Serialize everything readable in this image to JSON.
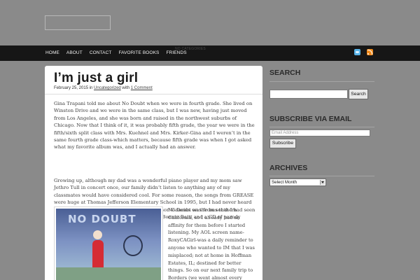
{
  "nav": {
    "items": [
      "HOME",
      "ABOUT",
      "CONTACT",
      "FAVORITE BOOKS",
      "FRIENDS"
    ],
    "sub_text": "NO CATEGORIES",
    "icons": [
      "twitter-icon",
      "rss-icon"
    ]
  },
  "post": {
    "title": "I’m just a girl",
    "date": "February 25, 2015",
    "in_text": "in",
    "category": "Uncategorized",
    "with_text": "with",
    "comments": "1 Comment",
    "paragraphs": [
      "Gina Trapani told me about No Doubt when we were in fourth grade. She lived on Winston Drive and we were in the same class, but I was new, having just moved from Los Angeles, and she was born and raised in the northwest suburbs of Chicago. Now that I think of it, it was probably fifth grade, the year we were in the fifth/sixth split class with Mrs. Kuehnel and Mrs. Kirker-Gina and I weren’t in the same fourth grade class-which matters, because fifth grade was when I got asked what my favorite album was, and I actually had an answer.",
      "Growing up, although my dad was a wonderful piano player and my mom saw Jethro Tull in concert once, our family didn’t listen to anything any of my classmates would have considered cool. For some reason, the songs from GREASE were huge at Thomas Jefferson Elementary School in 1995, but I had never heard of the movie except when I pretended to Allison Gaucius on the bus that I had seen it. Our family listened to Dan Fogelberg and Bonnie Raitt and a CD of parody songs called “Music to Operate By.”",
      "No Doubt was from southern California, so I already had an affinity for them before I started listening. My AOL screen name-RoxyCAGirl-was a daily reminder to anyone who wanted to IM that I was misplaced; not at home in Hoffman Estates, IL; destined for better things. So on our next family trip to Borders (we went almost every Sunday afternoon), I"
    ],
    "album_text": "NO DOUBT"
  },
  "sidebar": {
    "search_heading": "SEARCH",
    "search_button": "Search",
    "subscribe_heading": "SUBSCRIBE VIA EMAIL",
    "email_placeholder": "Email Address",
    "subscribe_button": "Subscribe",
    "archives_heading": "ARCHIVES",
    "archives_selected": "Select Month"
  },
  "colors": {
    "background": "#8a8a8a",
    "navbar": "#161616",
    "content_bg": "#ffffff",
    "twitter": "#59b3e8",
    "rss": "#f08a1c"
  }
}
